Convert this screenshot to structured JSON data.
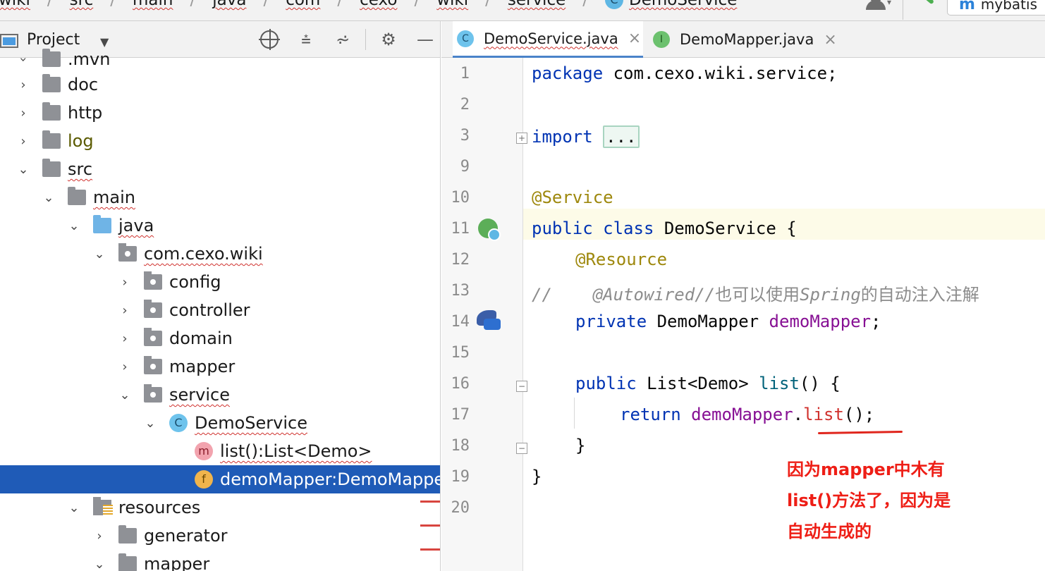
{
  "breadcrumb": {
    "items": [
      "wiki",
      "src",
      "main",
      "java",
      "com",
      "cexo",
      "wiki",
      "service",
      "DemoService"
    ],
    "separator": "/"
  },
  "toolbar": {
    "run_config_label": "mybatis",
    "run_config_icon": "m"
  },
  "project_panel": {
    "title": "Project",
    "tools": [
      "locate-icon",
      "expand-all-icon",
      "collapse-all-icon",
      "gear-icon",
      "minimize-icon"
    ]
  },
  "tree": {
    "rows": [
      {
        "label": ".mvn",
        "depth": 1,
        "arrow": "›",
        "icon": "folder"
      },
      {
        "label": "doc",
        "depth": 1,
        "arrow": "›",
        "icon": "folder"
      },
      {
        "label": "http",
        "depth": 1,
        "arrow": "›",
        "icon": "folder"
      },
      {
        "label": "log",
        "depth": 1,
        "arrow": "›",
        "icon": "folder"
      },
      {
        "label": "src",
        "depth": 1,
        "arrow": "⌄",
        "icon": "folder"
      },
      {
        "label": "main",
        "depth": 2,
        "arrow": "⌄",
        "icon": "folder"
      },
      {
        "label": "java",
        "depth": 3,
        "arrow": "⌄",
        "icon": "source-folder"
      },
      {
        "label": "com.cexo.wiki",
        "depth": 4,
        "arrow": "⌄",
        "icon": "package"
      },
      {
        "label": "config",
        "depth": 5,
        "arrow": "›",
        "icon": "package"
      },
      {
        "label": "controller",
        "depth": 5,
        "arrow": "›",
        "icon": "package"
      },
      {
        "label": "domain",
        "depth": 5,
        "arrow": "›",
        "icon": "package"
      },
      {
        "label": "mapper",
        "depth": 5,
        "arrow": "›",
        "icon": "package"
      },
      {
        "label": "service",
        "depth": 5,
        "arrow": "⌄",
        "icon": "package"
      },
      {
        "label": "DemoService",
        "depth": 6,
        "arrow": "⌄",
        "icon": "class",
        "icon_letter": "C"
      },
      {
        "label": "list():List<Demo>",
        "depth": 7,
        "icon": "method",
        "icon_letter": "m"
      },
      {
        "label": "demoMapper:DemoMapper",
        "depth": 7,
        "icon": "field",
        "icon_letter": "f",
        "selected": true
      },
      {
        "label": "resources",
        "depth": 3,
        "arrow": "⌄",
        "icon": "resources-folder"
      },
      {
        "label": "generator",
        "depth": 4,
        "arrow": "›",
        "icon": "folder"
      },
      {
        "label": "mapper",
        "depth": 4,
        "arrow": "⌄",
        "icon": "folder"
      }
    ]
  },
  "editor": {
    "tabs": [
      {
        "label": "DemoService.java",
        "icon_letter": "C",
        "active": true,
        "close": "×"
      },
      {
        "label": "DemoMapper.java",
        "icon_letter": "I",
        "active": false,
        "close": "×"
      }
    ],
    "lines": [
      {
        "num": "1"
      },
      {
        "num": "2"
      },
      {
        "num": "3"
      },
      {
        "num": "9"
      },
      {
        "num": "10"
      },
      {
        "num": "11"
      },
      {
        "num": "12"
      },
      {
        "num": "13"
      },
      {
        "num": "14"
      },
      {
        "num": "15"
      },
      {
        "num": "16"
      },
      {
        "num": "17"
      },
      {
        "num": "18"
      },
      {
        "num": "19"
      },
      {
        "num": "20"
      }
    ],
    "code": {
      "l1_kw": "package",
      "l1_rest": " com.cexo.wiki.service;",
      "l3_kw": "import",
      "l3_fold": "...",
      "l10_ann": "@Service",
      "l11_kw1": "public",
      "l11_kw2": "class",
      "l11_rest": " DemoService {",
      "l12_ann": "@Resource",
      "l13_prefix": "//",
      "l13_ann": "@Autowired//",
      "l13_cn1": "也可以使用",
      "l13_spring": "Spring",
      "l13_cn2": "的自动注入注解",
      "l14_kw": "private",
      "l14_type": " DemoMapper ",
      "l14_field": "demoMapper",
      "l14_end": ";",
      "l16_kw": "public",
      "l16_type": " List<Demo> ",
      "l16_method": "list",
      "l16_end": "() {",
      "l17_kw": "return",
      "l17_field": "demoMapper",
      "l17_dot": ".",
      "l17_method": "list",
      "l17_end": "();",
      "l18": "}",
      "l19": "}"
    },
    "note": "因为mapper中木有\nlist()方法了，因为是\n自动生成的",
    "colors": {
      "keyword": "#0033b3",
      "annotation": "#9e880d",
      "field": "#871094",
      "method": "#00627a",
      "comment": "#8c8c8c",
      "note": "#ee1e16",
      "selection": "#1f5bb7"
    }
  }
}
